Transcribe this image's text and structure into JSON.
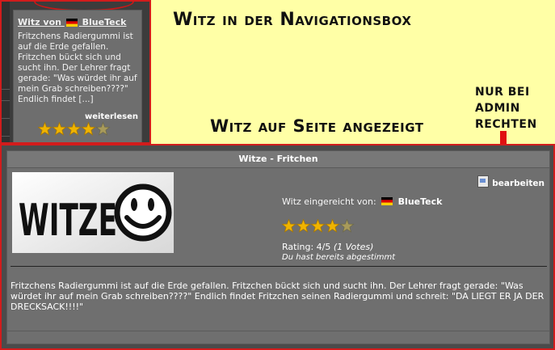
{
  "navbox": {
    "title_prefix": "Witz von",
    "author": "BlueTeck",
    "excerpt": "Fritzchens Radiergummi ist auf die Erde gefallen. Fritzchen bückt sich und sucht ihn. Der Lehrer fragt gerade: \"Was würdet ihr auf mein Grab schreiben????\" Endlich findet [...]",
    "more_link": "weiterlesen",
    "stars_rating": 4,
    "stars_max": 5
  },
  "annotations": {
    "navbox_label": "Witz in der Navigationsbox",
    "page_label": "Witz auf Seite angezeigt",
    "admin_note": [
      "Nur bei",
      "Admin",
      "Rechten"
    ]
  },
  "panel": {
    "title": "Witze - Fritchen",
    "edit_label": "bearbeiten",
    "logo_text": "WITZE",
    "submitted_label": "Witz eingereicht von:",
    "author": "BlueTeck",
    "stars_rating": 4,
    "stars_max": 5,
    "rating_text": "Rating: 4/5",
    "votes_text": "(1 Votes)",
    "voted_text": "Du hast bereits abgestimmt",
    "joke_text": "Fritzchens Radiergummi ist auf die Erde gefallen. Fritzchen bückt sich und sucht ihn. Der Lehrer fragt gerade: \"Was würdet ihr auf mein Grab schreiben????\" Endlich findet Fritzchen seinen Radiergummi und schreit: \"DA LIEGT ER JA DER DRECKSACK!!!!\""
  },
  "colors": {
    "highlight_border": "#d21c1c",
    "background": "#ffffa6",
    "star_fill": "#f0b400",
    "arrow": "#e01010"
  },
  "icons": [
    "german-flag-icon",
    "star-icon",
    "edit-document-icon",
    "smiley-icon",
    "arrow-down-icon"
  ]
}
